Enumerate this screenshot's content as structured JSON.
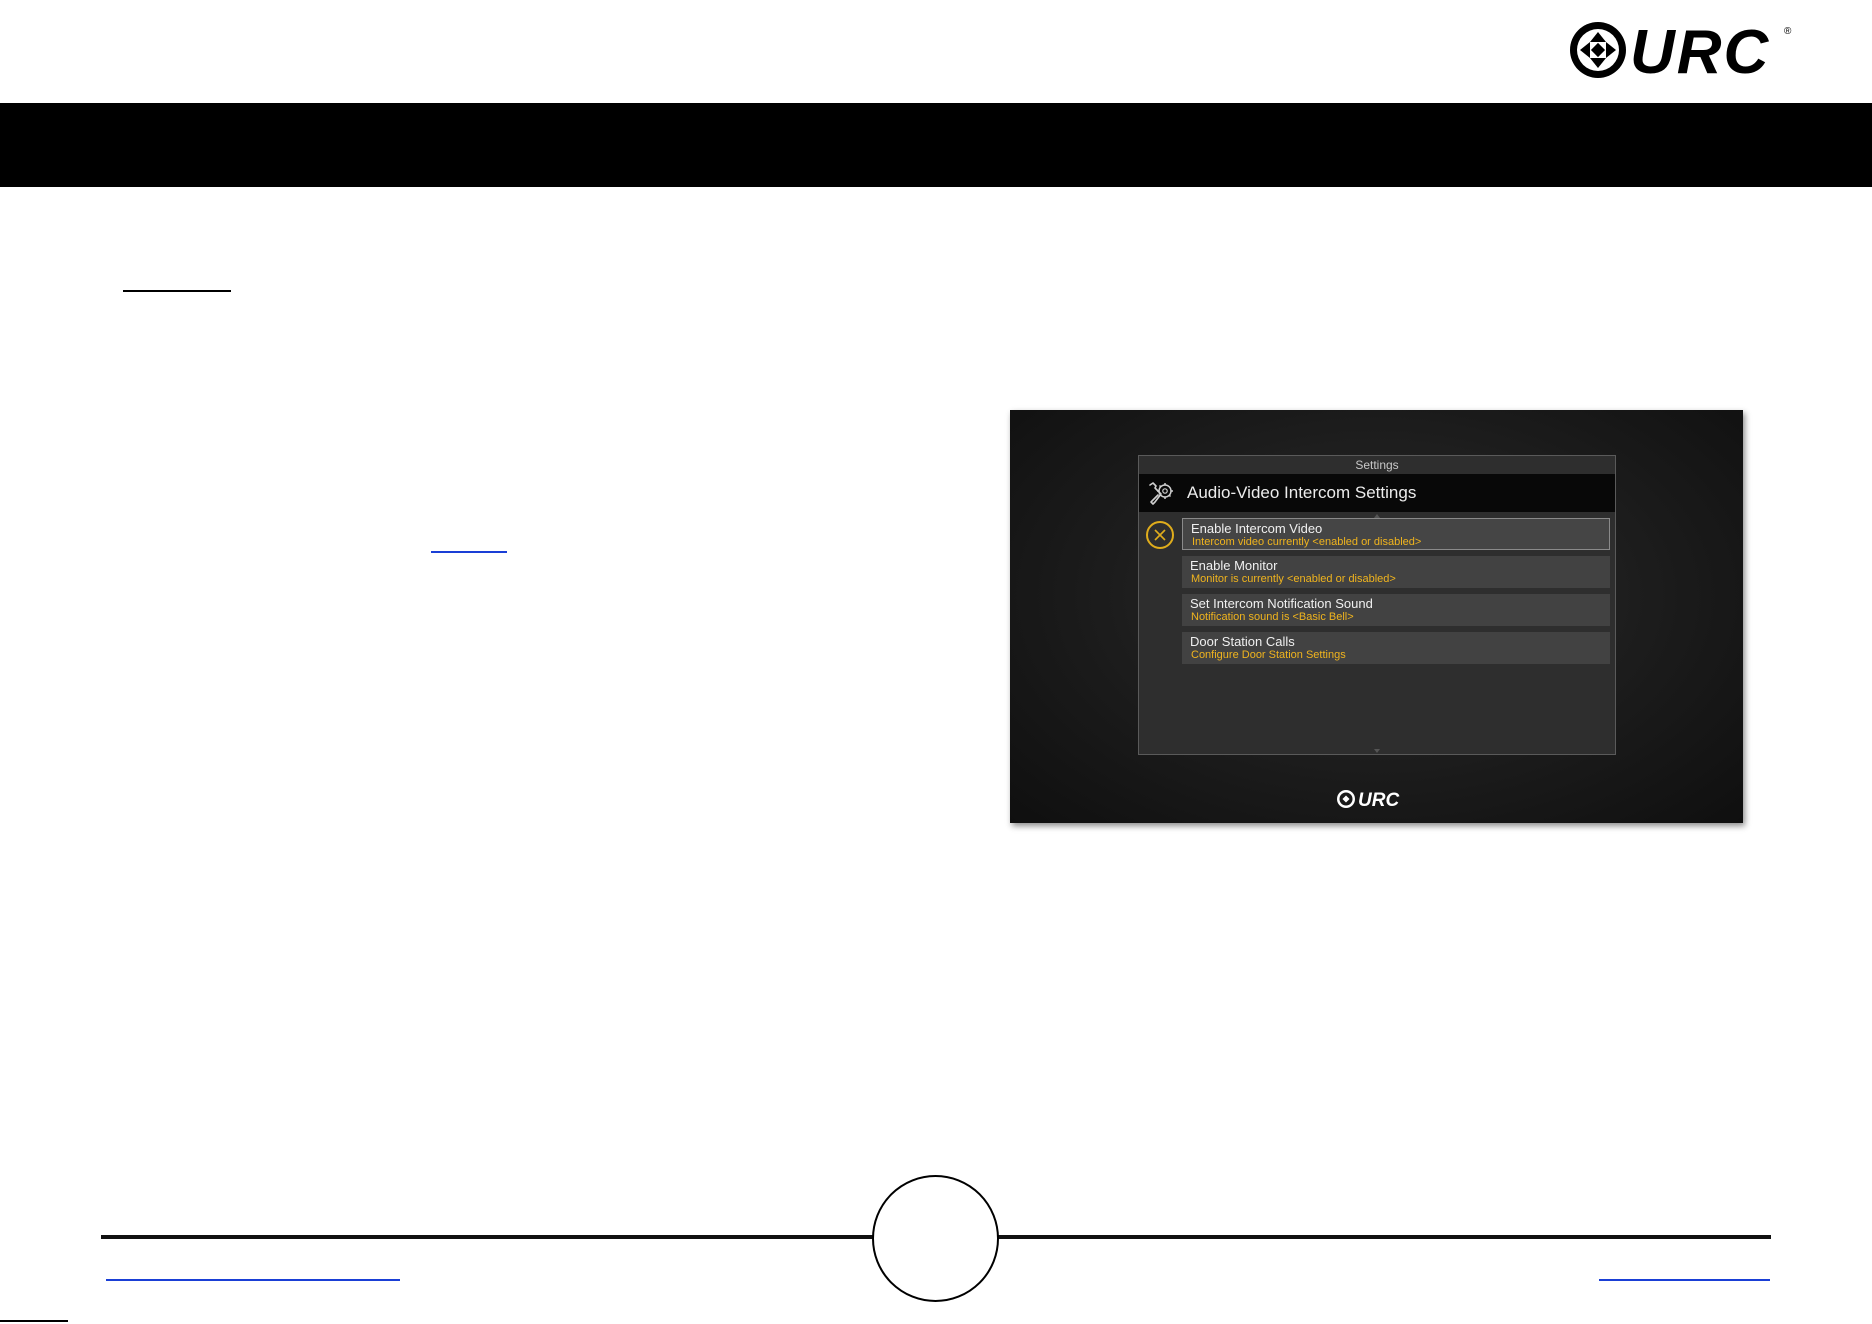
{
  "brand": {
    "logo_icon": "urc-logo-icon",
    "logo_text": "URC",
    "registered_mark": "®"
  },
  "device_screen": {
    "caption": "Settings",
    "title": "Audio-Video Intercom Settings",
    "header_icon": "settings-wrench-gear-icon",
    "close_icon": "close-circle-icon",
    "items": [
      {
        "title": "Enable Intercom Video",
        "subtitle": "Intercom video currently <enabled or disabled>"
      },
      {
        "title": "Enable Monitor",
        "subtitle": "Monitor is currently <enabled or disabled>"
      },
      {
        "title": "Set Intercom Notification Sound",
        "subtitle": "Notification sound is <Basic Bell>"
      },
      {
        "title": "Door Station Calls",
        "subtitle": "Configure Door Station Settings"
      }
    ],
    "footer_logo_text": "URC"
  },
  "colors": {
    "accent": "#f0b41e",
    "top_bar": "#000000",
    "link": "#1a3fd6"
  }
}
